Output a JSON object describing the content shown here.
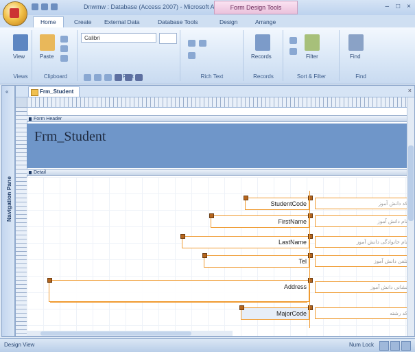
{
  "window": {
    "title": "Dnwmw : Database (Access 2007) - Microsoft Access",
    "context_tab": "Form Design Tools",
    "controls": [
      "–",
      "□",
      "×"
    ]
  },
  "ribbon": {
    "tabs": [
      "Home",
      "Create",
      "External Data",
      "Database Tools",
      "Design",
      "Arrange"
    ],
    "active_tab": "Home",
    "groups": [
      "Views",
      "Clipboard",
      "Font",
      "Rich Text",
      "Records",
      "Sort & Filter",
      "Find"
    ],
    "buttons": {
      "view": "View",
      "paste": "Paste",
      "records": "Records",
      "find": "Find",
      "filter": "Filter"
    },
    "font_name": "Calibri"
  },
  "nav_pane": {
    "label": "Navigation Pane",
    "toggle": "«"
  },
  "document": {
    "tab_label": "Frm_Student",
    "close": "×",
    "sections": {
      "header": "Form Header",
      "detail": "Detail"
    },
    "form_title": "Frm_Student"
  },
  "fields": [
    {
      "label": "StudentCode",
      "placeholder": "کد دانش آموز"
    },
    {
      "label": "FirstName",
      "placeholder": "نام دانش آموز"
    },
    {
      "label": "LastName",
      "placeholder": "نام خانوادگی دانش آموز"
    },
    {
      "label": "Tel",
      "placeholder": "تلفن دانش آموز"
    },
    {
      "label": "Address",
      "placeholder": "نشانی دانش آموز"
    },
    {
      "label": "MajorCode",
      "placeholder": "کد رشته"
    }
  ],
  "status": {
    "left": "Design View",
    "right": "Num Lock"
  },
  "colors": {
    "header_band": "#6f96c9",
    "selection_border": "#ef9a30",
    "ribbon": "#d8e6f6"
  }
}
